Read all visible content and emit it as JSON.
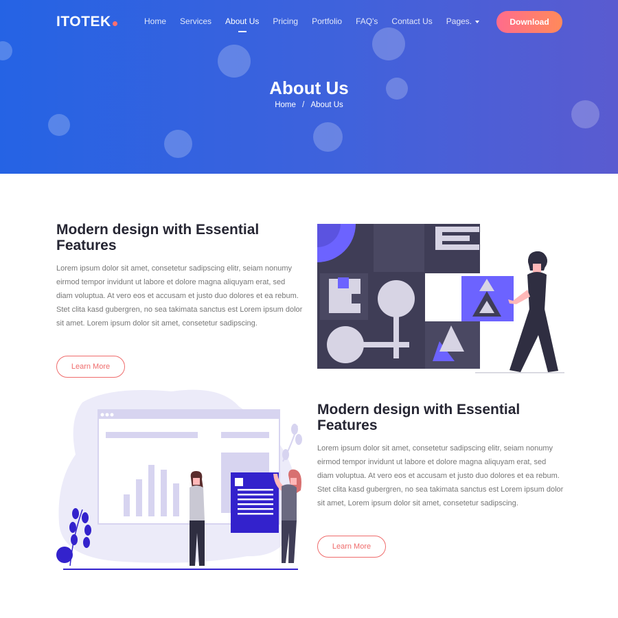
{
  "brand": {
    "name": "ITOTEK",
    "accent": "#ff6f6f"
  },
  "nav": {
    "items": [
      {
        "label": "Home"
      },
      {
        "label": "Services"
      },
      {
        "label": "About Us"
      },
      {
        "label": "Pricing"
      },
      {
        "label": "Portfolio"
      },
      {
        "label": "FAQ's"
      },
      {
        "label": "Contact Us"
      },
      {
        "label": "Pages."
      }
    ],
    "active": "About Us",
    "download_label": "Download"
  },
  "hero": {
    "title": "About Us",
    "breadcrumb": {
      "home": "Home",
      "separator": "/",
      "current": "About Us"
    }
  },
  "sections": [
    {
      "title": "Modern design with Essential Features",
      "body": "Lorem ipsum dolor sit amet, consetetur sadipscing elitr, seiam nonumy eirmod tempor invidunt ut labore et dolore magna aliquyam erat, sed diam voluptua. At vero eos et accusam et justo duo dolores et ea rebum. Stet clita kasd gubergren, no sea takimata sanctus est Lorem ipsum dolor sit amet. Lorem ipsum dolor sit amet, consetetur sadipscing.",
      "button": "Learn More"
    },
    {
      "title": "Modern design with Essential Features",
      "body": "Lorem ipsum dolor sit amet, consetetur sadipscing elitr, seiam nonumy eirmod tempor invidunt ut labore et dolore magna aliquyam erat, sed diam voluptua. At vero eos et accusam et justo duo dolores et ea rebum. Stet clita kasd gubergren, no sea takimata sanctus est Lorem ipsum dolor sit amet, Lorem ipsum dolor sit amet, consetetur sadipscing.",
      "button": "Learn More"
    }
  ],
  "colors": {
    "hero_start": "#2563e4",
    "hero_end": "#5a5bd0",
    "accent_purple": "#6c63ff",
    "dark": "#3f3d56"
  }
}
